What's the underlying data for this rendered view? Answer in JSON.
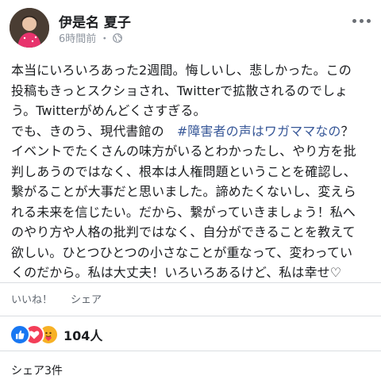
{
  "post": {
    "author": "伊是名 夏子",
    "time": "6時間前",
    "separator": "・",
    "privacy_icon": "globe-icon",
    "more_icon": "more-options-icon",
    "body_lines": [
      {
        "text": "本当にいろいろあった2週間。悔しいし、悲しかった。この"
      },
      {
        "text": "投稿もきっとスクショされ、Twitterで拡散されるのでしょ"
      },
      {
        "text": "う。Twitterがめんどくさすぎる。"
      },
      {
        "text": "でも、きのう、現代書館の　",
        "hashtag": "#障害者の声はワガママなの",
        "after": "？"
      },
      {
        "text": "イベントでたくさんの味方がいるとわかったし、やり方を批"
      },
      {
        "text": "判しあうのではなく、根本は人権問題ということを確認し、"
      },
      {
        "text": "繋がることが大事だと思いました。諦めたくないし、変えら"
      },
      {
        "text": "れる未来を信じたい。だから、繋がっていきましょう！私へ"
      },
      {
        "text": "のやり方や人格の批判ではなく、自分ができることを教えて"
      },
      {
        "text": "欲しい。ひとつひとつの小さなことが重なって、変わってい"
      },
      {
        "text": "くのだから。私は大丈夫！いろいろあるけど、私は幸せ♡"
      }
    ]
  },
  "actions": {
    "like_label": "いいね！",
    "share_label": "シェア"
  },
  "reactions": {
    "icons": [
      "like-reaction-icon",
      "love-reaction-icon",
      "care-reaction-icon"
    ],
    "count": "104人"
  },
  "shares": {
    "label": "シェア3件"
  },
  "colors": {
    "hashtag": "#385898",
    "like": "#1877f2",
    "love": "#f33e58",
    "care": "#f7b125",
    "muted": "#8d949e"
  }
}
